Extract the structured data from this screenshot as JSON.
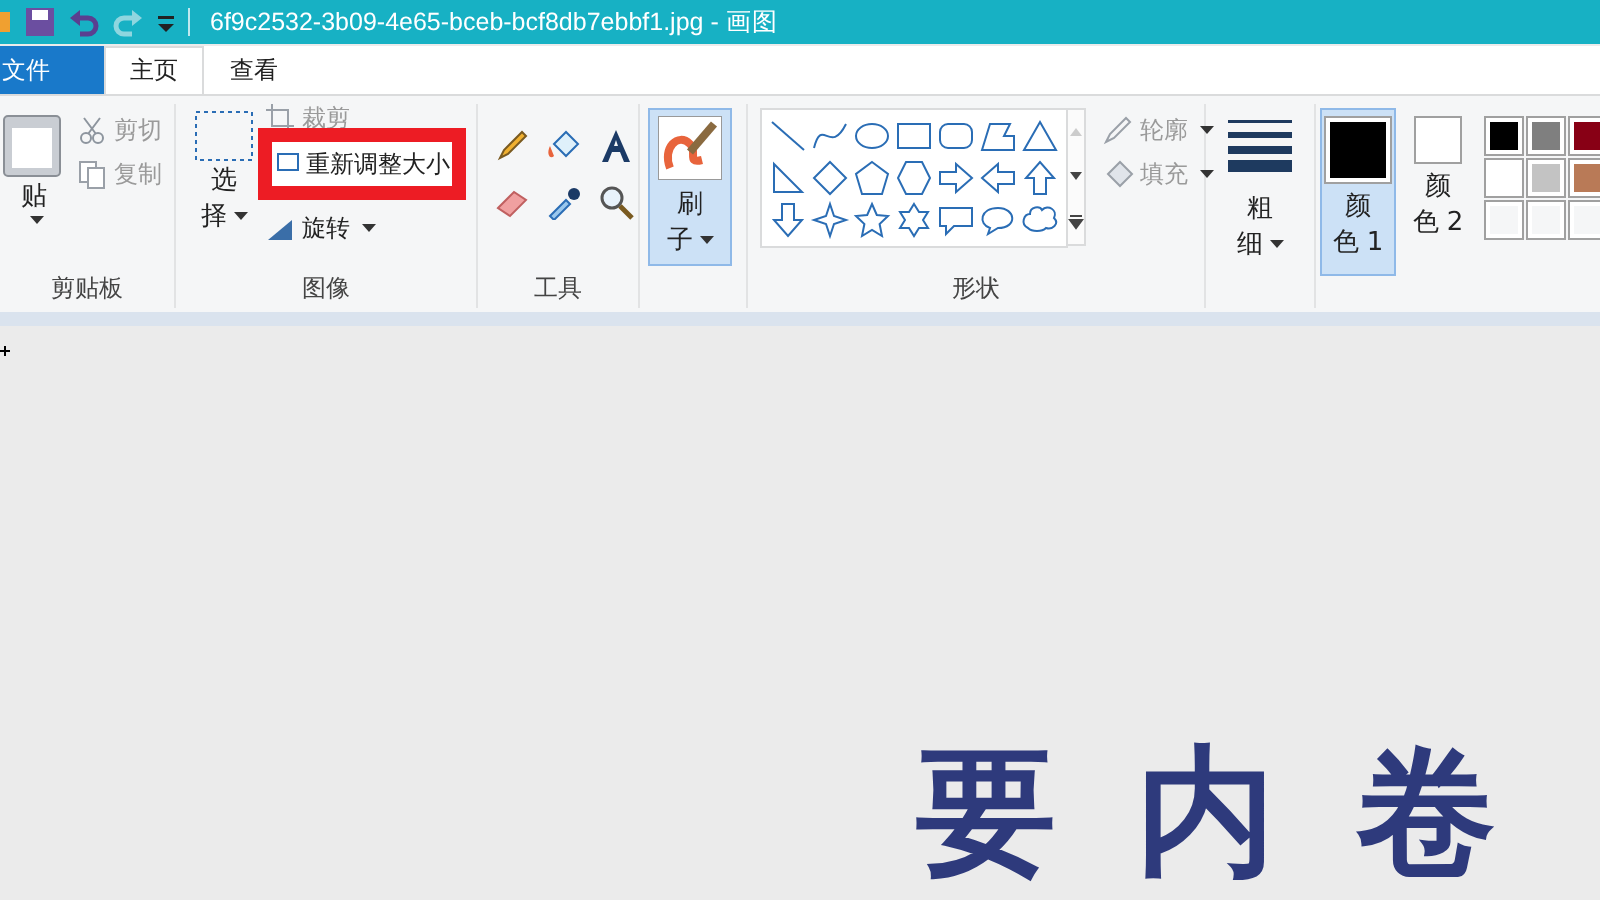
{
  "title_bar": {
    "title": "6f9c2532-3b09-4e65-bceb-bcf8db7ebbf1.jpg - 画图"
  },
  "tabs": [
    {
      "label": "文件",
      "kind": "file",
      "selected": false
    },
    {
      "label": "主页",
      "kind": "tab",
      "selected": true
    },
    {
      "label": "查看",
      "kind": "tab",
      "selected": false
    }
  ],
  "clipboard": {
    "label": "剪贴板",
    "paste": "贴",
    "cut": {
      "label": "剪切",
      "disabled": true
    },
    "copy": {
      "label": "复制",
      "disabled": true
    }
  },
  "image": {
    "label": "图像",
    "select_lines": [
      "选",
      "择"
    ],
    "crop": {
      "label": "裁剪",
      "disabled": true
    },
    "resize": "重新调整大小",
    "rotate": "旋转"
  },
  "tools": {
    "label": "工具"
  },
  "brushes": {
    "label_lines": [
      "刷",
      "子"
    ],
    "selected": true
  },
  "shapes": {
    "label": "形状",
    "outline": {
      "label": "轮廓",
      "disabled": true
    },
    "fill": {
      "label": "填充",
      "disabled": true
    }
  },
  "size": {
    "label_lines": [
      "粗",
      "细"
    ]
  },
  "colors": [
    {
      "label_lines": [
        "颜",
        "色 1"
      ],
      "selected": true,
      "color": "#000000"
    },
    {
      "label_lines": [
        "颜",
        "色 2"
      ],
      "selected": false,
      "color": "#ffffff"
    }
  ],
  "palette": [
    {
      "color": "#000000"
    },
    {
      "color": "#7f7f7f"
    },
    {
      "color": "#880015"
    },
    {
      "color": "#ffffff"
    },
    {
      "color": "#c3c3c3"
    },
    {
      "color": "#b97a57"
    },
    {
      "color": "#f5f6f7"
    },
    {
      "color": "#f5f6f7"
    },
    {
      "color": "#f5f6f7"
    }
  ],
  "canvas": {
    "text": "要内卷"
  }
}
